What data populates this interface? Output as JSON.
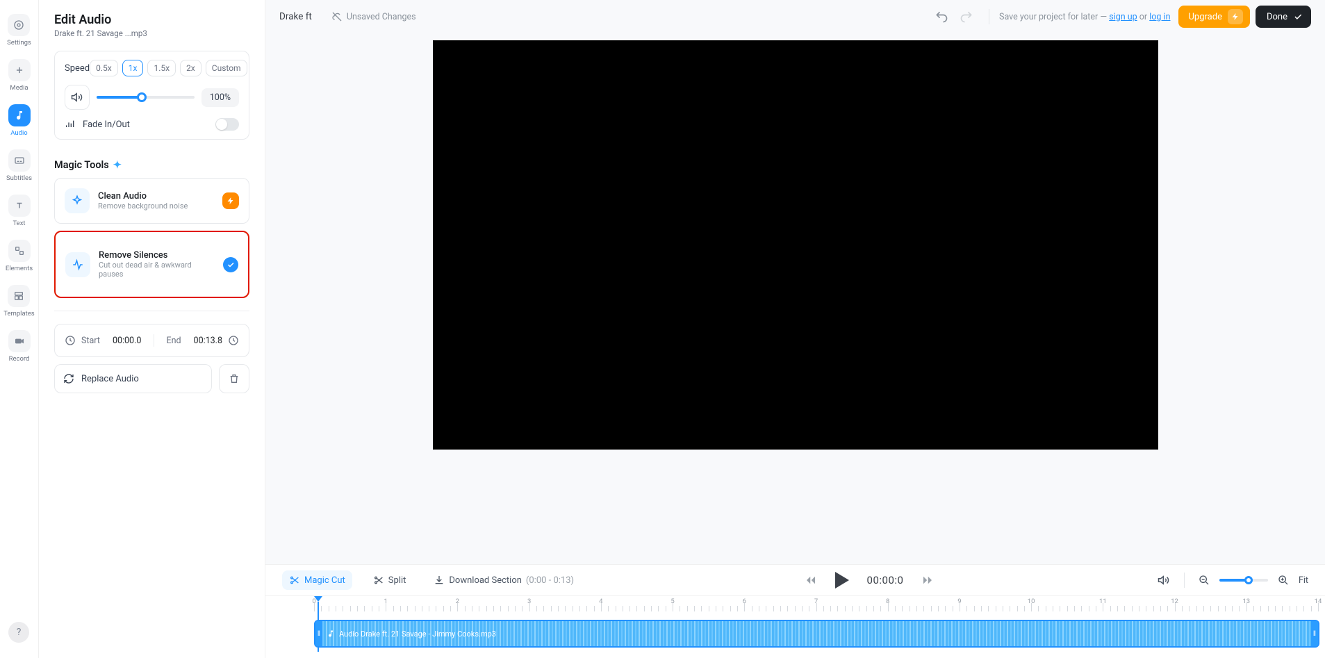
{
  "nav": {
    "items": [
      {
        "label": "Settings"
      },
      {
        "label": "Media"
      },
      {
        "label": "Audio"
      },
      {
        "label": "Subtitles"
      },
      {
        "label": "Text"
      },
      {
        "label": "Elements"
      },
      {
        "label": "Templates"
      },
      {
        "label": "Record"
      }
    ]
  },
  "panel": {
    "title": "Edit Audio",
    "subtitle": "Drake ft. 21 Savage ...mp3",
    "speed": {
      "label": "Speed",
      "options": [
        "0.5x",
        "1x",
        "1.5x",
        "2x",
        "Custom"
      ],
      "active": "1x"
    },
    "volume": {
      "percent": "100%"
    },
    "fade": {
      "label": "Fade In/Out"
    },
    "magic_title": "Magic Tools",
    "tools": [
      {
        "title": "Clean Audio",
        "sub": "Remove background noise"
      },
      {
        "title": "Remove Silences",
        "sub": "Cut out dead air & awkward pauses"
      }
    ],
    "time": {
      "start_label": "Start",
      "start": "00:00.0",
      "end_label": "End",
      "end": "00:13.8"
    },
    "replace": "Replace Audio"
  },
  "top": {
    "project": "Drake ft",
    "unsaved": "Unsaved Changes",
    "save_prompt": "Save your project for later —",
    "signup": "sign up",
    "or": "or",
    "login": "log in",
    "upgrade": "Upgrade",
    "done": "Done"
  },
  "bottom": {
    "magic_cut": "Magic Cut",
    "split": "Split",
    "download": "Download Section",
    "download_range": "(0:00 - 0:13)",
    "time": "00:00:0",
    "fit": "Fit"
  },
  "timeline": {
    "clip_label": "Audio Drake ft. 21 Savage - Jimmy Cooks.mp3"
  }
}
